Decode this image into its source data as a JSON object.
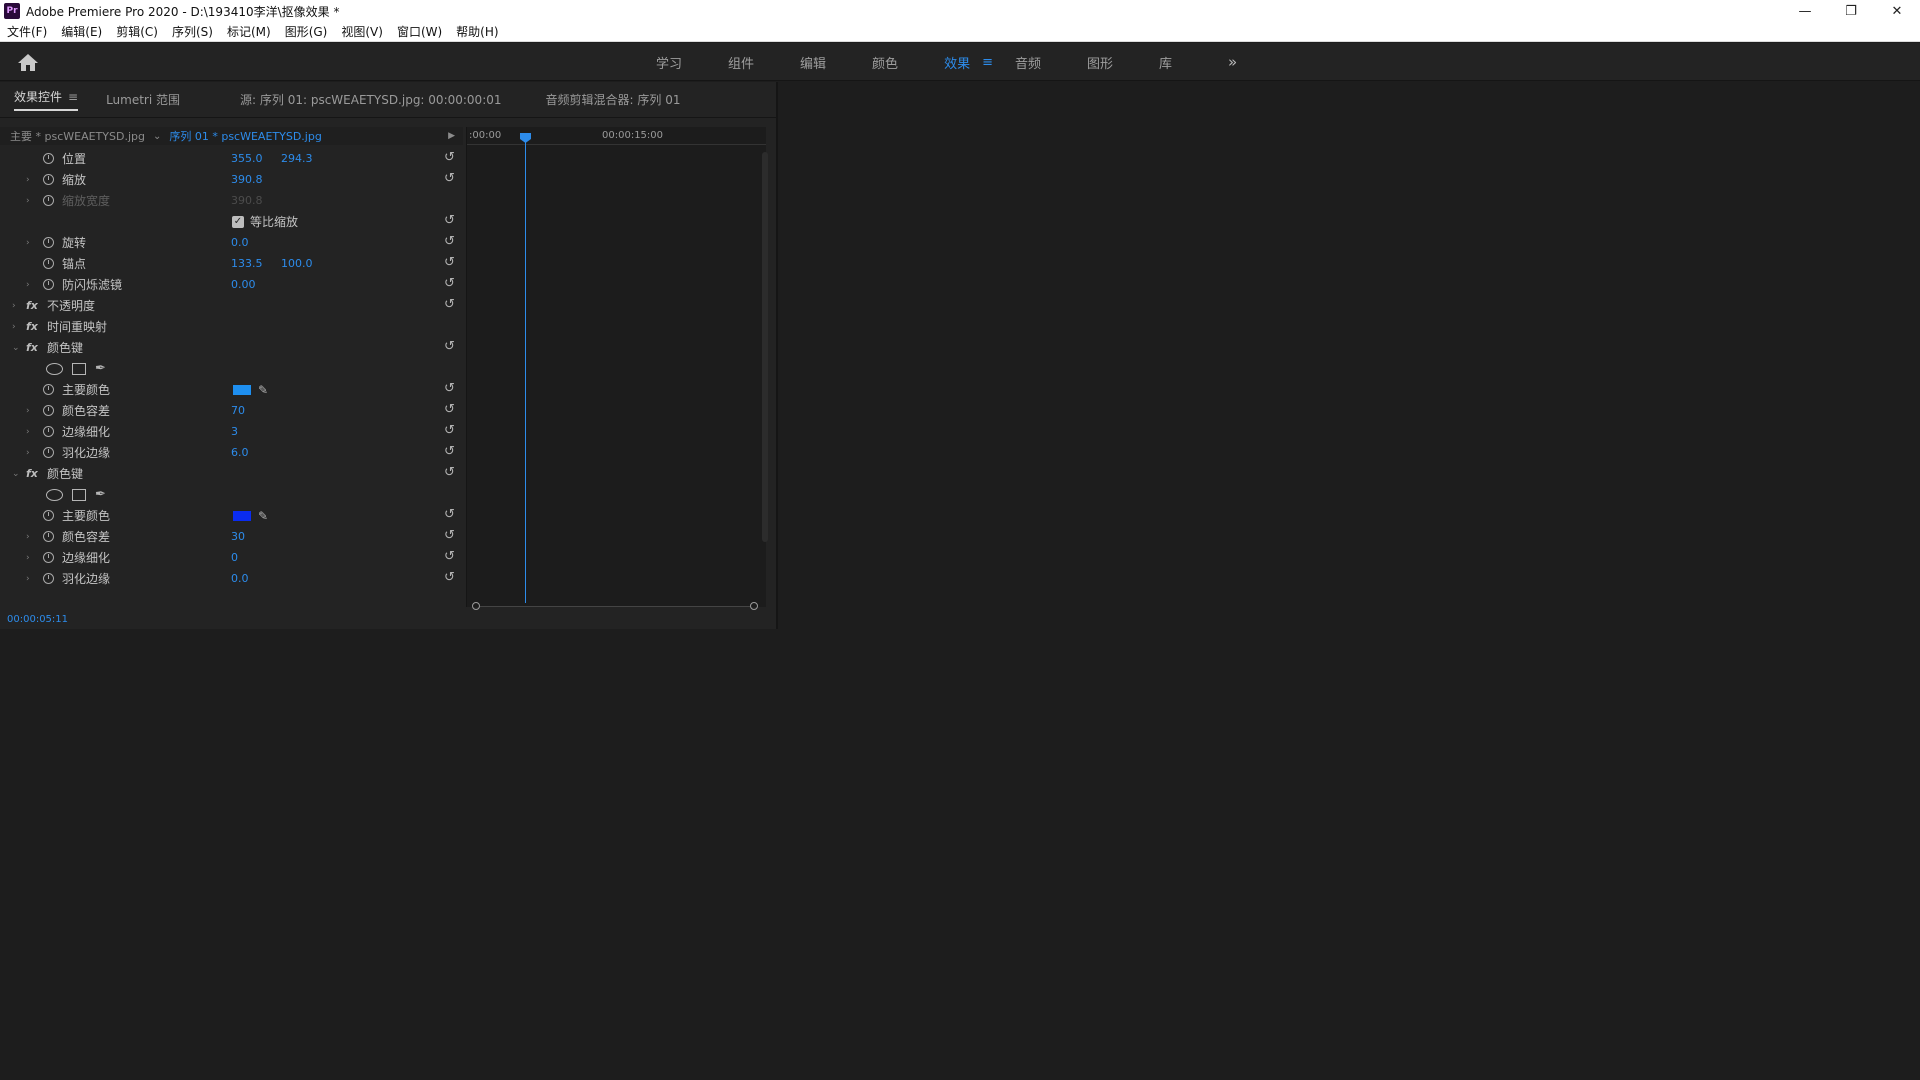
{
  "window": {
    "app_icon": "Pr",
    "title": "Adobe Premiere Pro 2020 - D:\\193410李洋\\抠像效果 *",
    "controls": {
      "minimize": "—",
      "maximize": "❐",
      "close": "✕"
    }
  },
  "menu": [
    "文件(F)",
    "编辑(E)",
    "剪辑(C)",
    "序列(S)",
    "标记(M)",
    "图形(G)",
    "视图(V)",
    "窗口(W)",
    "帮助(H)"
  ],
  "workspaces": {
    "tabs": [
      "学习",
      "组件",
      "编辑",
      "颜色",
      "效果",
      "音频",
      "图形",
      "库"
    ],
    "active": "效果",
    "menu_icon": "≡",
    "more": "»"
  },
  "effect_controls": {
    "tabs": [
      "效果控件",
      "Lumetri 范围",
      "源: 序列 01: pscWEAETYSD.jpg: 00:00:00:01",
      "音频剪辑混合器: 序列 01"
    ],
    "menu_icon": "≡",
    "master_label": "主要 * pscWEAETYSD.jpg",
    "sequence_label": "序列 01 * pscWEAETYSD.jpg",
    "ruler": {
      "start": ":00:00",
      "mid": "00:00:15:00"
    },
    "current_time": "00:00:05:11",
    "uniform_scale_label": "等比缩放",
    "rows": [
      {
        "kind": "prop",
        "name": "位置",
        "v1": "355.0",
        "v2": "294.3",
        "twirl": false
      },
      {
        "kind": "prop",
        "name": "缩放",
        "v1": "390.8",
        "twirl": true
      },
      {
        "kind": "prop",
        "name": "缩放宽度",
        "v1": "390.8",
        "twirl": true,
        "disabled": true
      },
      {
        "kind": "checkbox",
        "label": "等比缩放"
      },
      {
        "kind": "prop",
        "name": "旋转",
        "v1": "0.0",
        "twirl": true
      },
      {
        "kind": "prop",
        "name": "锚点",
        "v1": "133.5",
        "v2": "100.0",
        "twirl": false
      },
      {
        "kind": "prop",
        "name": "防闪烁滤镜",
        "v1": "0.00",
        "twirl": true
      },
      {
        "kind": "section",
        "name": "不透明度"
      },
      {
        "kind": "section",
        "name": "时间重映射",
        "noreset": true
      },
      {
        "kind": "section",
        "name": "颜色键",
        "open": true
      },
      {
        "kind": "mask"
      },
      {
        "kind": "color",
        "name": "主要颜色",
        "color": "#1e8ff0"
      },
      {
        "kind": "prop",
        "name": "颜色容差",
        "v1": "70",
        "twirl": true
      },
      {
        "kind": "prop",
        "name": "边缘细化",
        "v1": "3",
        "twirl": true
      },
      {
        "kind": "prop",
        "name": "羽化边缘",
        "v1": "6.0",
        "twirl": true
      },
      {
        "kind": "section",
        "name": "颜色键",
        "open": true
      },
      {
        "kind": "mask"
      },
      {
        "kind": "color",
        "name": "主要颜色",
        "color": "#0a2cf0"
      },
      {
        "kind": "prop",
        "name": "颜色容差",
        "v1": "30",
        "twirl": true
      },
      {
        "kind": "prop",
        "name": "边缘细化",
        "v1": "0",
        "twirl": true
      },
      {
        "kind": "prop",
        "name": "羽化边缘",
        "v1": "0.0",
        "twirl": true
      }
    ]
  }
}
